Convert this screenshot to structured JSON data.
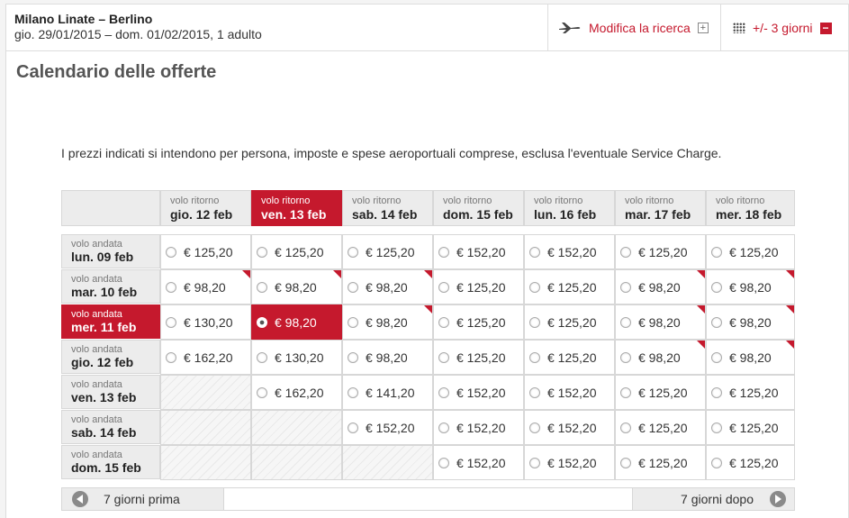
{
  "header": {
    "route": "Milano Linate – Berlino",
    "dates": "gio. 29/01/2015 – dom. 01/02/2015, 1 adulto",
    "modify_label": "Modifica la ricerca",
    "modify_icon": "plus-box-icon",
    "plus_minus_label": "+/- 3 giorni",
    "plus_minus_icon": "minus-box-icon",
    "accent_color": "#c5192d"
  },
  "title": "Calendario delle offerte",
  "note": "I prezzi indicati si intendono per persona, imposte e spese aeroportuali comprese, esclusa l'eventuale Service Charge.",
  "columns": [
    {
      "label": "volo ritorno",
      "date": "gio. 12 feb",
      "selected": false
    },
    {
      "label": "volo ritorno",
      "date": "ven. 13 feb",
      "selected": true
    },
    {
      "label": "volo ritorno",
      "date": "sab. 14 feb",
      "selected": false
    },
    {
      "label": "volo ritorno",
      "date": "dom. 15 feb",
      "selected": false
    },
    {
      "label": "volo ritorno",
      "date": "lun. 16 feb",
      "selected": false
    },
    {
      "label": "volo ritorno",
      "date": "mar. 17 feb",
      "selected": false
    },
    {
      "label": "volo ritorno",
      "date": "mer. 18 feb",
      "selected": false
    }
  ],
  "rows": [
    {
      "label": "volo andata",
      "date": "lun. 09 feb",
      "selected": false,
      "cells": [
        {
          "price": "€ 125,20"
        },
        {
          "price": "€ 125,20"
        },
        {
          "price": "€ 125,20"
        },
        {
          "price": "€ 152,20"
        },
        {
          "price": "€ 152,20"
        },
        {
          "price": "€ 125,20"
        },
        {
          "price": "€ 125,20"
        }
      ]
    },
    {
      "label": "volo andata",
      "date": "mar. 10 feb",
      "selected": false,
      "cells": [
        {
          "price": "€ 98,20",
          "flag": true
        },
        {
          "price": "€ 98,20",
          "flag": true
        },
        {
          "price": "€ 98,20",
          "flag": true
        },
        {
          "price": "€ 125,20"
        },
        {
          "price": "€ 125,20"
        },
        {
          "price": "€ 98,20",
          "flag": true
        },
        {
          "price": "€ 98,20",
          "flag": true
        }
      ]
    },
    {
      "label": "volo andata",
      "date": "mer. 11 feb",
      "selected": true,
      "cells": [
        {
          "price": "€ 130,20"
        },
        {
          "price": "€ 98,20",
          "selected": true
        },
        {
          "price": "€ 98,20",
          "flag": true
        },
        {
          "price": "€ 125,20"
        },
        {
          "price": "€ 125,20"
        },
        {
          "price": "€ 98,20",
          "flag": true
        },
        {
          "price": "€ 98,20",
          "flag": true
        }
      ]
    },
    {
      "label": "volo andata",
      "date": "gio. 12 feb",
      "selected": false,
      "cells": [
        {
          "price": "€ 162,20"
        },
        {
          "price": "€ 130,20"
        },
        {
          "price": "€ 98,20"
        },
        {
          "price": "€ 125,20"
        },
        {
          "price": "€ 125,20"
        },
        {
          "price": "€ 98,20",
          "flag": true
        },
        {
          "price": "€ 98,20",
          "flag": true
        }
      ]
    },
    {
      "label": "volo andata",
      "date": "ven. 13 feb",
      "selected": false,
      "cells": [
        {
          "price": null
        },
        {
          "price": "€ 162,20"
        },
        {
          "price": "€ 141,20"
        },
        {
          "price": "€ 152,20"
        },
        {
          "price": "€ 152,20"
        },
        {
          "price": "€ 125,20"
        },
        {
          "price": "€ 125,20"
        }
      ]
    },
    {
      "label": "volo andata",
      "date": "sab. 14 feb",
      "selected": false,
      "cells": [
        {
          "price": null
        },
        {
          "price": null
        },
        {
          "price": "€ 152,20"
        },
        {
          "price": "€ 152,20"
        },
        {
          "price": "€ 152,20"
        },
        {
          "price": "€ 125,20"
        },
        {
          "price": "€ 125,20"
        }
      ]
    },
    {
      "label": "volo andata",
      "date": "dom. 15 feb",
      "selected": false,
      "cells": [
        {
          "price": null
        },
        {
          "price": null
        },
        {
          "price": null
        },
        {
          "price": "€ 152,20"
        },
        {
          "price": "€ 152,20"
        },
        {
          "price": "€ 125,20"
        },
        {
          "price": "€ 125,20"
        }
      ]
    }
  ],
  "nav": {
    "prev_label": "7 giorni prima",
    "next_label": "7 giorni dopo"
  }
}
